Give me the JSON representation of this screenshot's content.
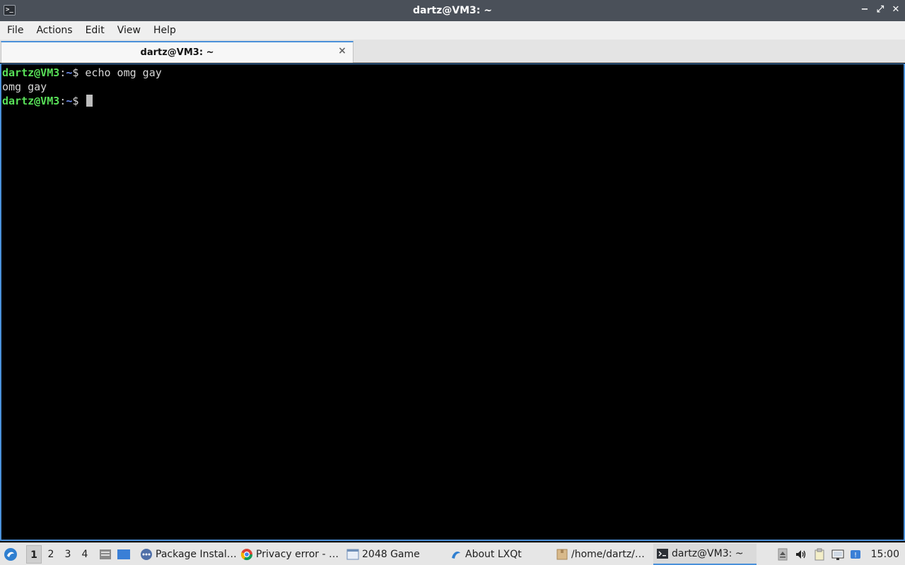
{
  "window": {
    "title": "dartz@VM3: ~",
    "controls": {
      "minimize": "−",
      "maximize": "⤢",
      "close": "✕"
    }
  },
  "menubar": {
    "items": [
      "File",
      "Actions",
      "Edit",
      "View",
      "Help"
    ]
  },
  "tabs": [
    {
      "label": "dartz@VM3: ~",
      "close": "×"
    }
  ],
  "terminal": {
    "lines": [
      {
        "user": "dartz@VM3",
        "colon": ":",
        "path": "~",
        "sign": "$ ",
        "command": "echo omg gay"
      },
      {
        "output": "omg gay"
      },
      {
        "user": "dartz@VM3",
        "colon": ":",
        "path": "~",
        "sign": "$ ",
        "command": ""
      }
    ]
  },
  "taskbar": {
    "desktops": [
      "1",
      "2",
      "3",
      "4"
    ],
    "active_desktop": "1",
    "tasks": [
      {
        "label": "Package Instal…",
        "icon": "package-installer-icon"
      },
      {
        "label": "Privacy error - …",
        "icon": "chrome-icon"
      },
      {
        "label": "2048 Game",
        "icon": "window-icon"
      },
      {
        "label": "About LXQt",
        "icon": "lxqt-icon"
      },
      {
        "label": "/home/dartz/…",
        "icon": "folder-icon"
      },
      {
        "label": "dartz@VM3: ~",
        "icon": "terminal-icon",
        "active": true
      }
    ],
    "clock": "15:00"
  },
  "colors": {
    "accent": "#4a90d9",
    "prompt_user": "#58e058",
    "prompt_path": "#6f8fef"
  }
}
